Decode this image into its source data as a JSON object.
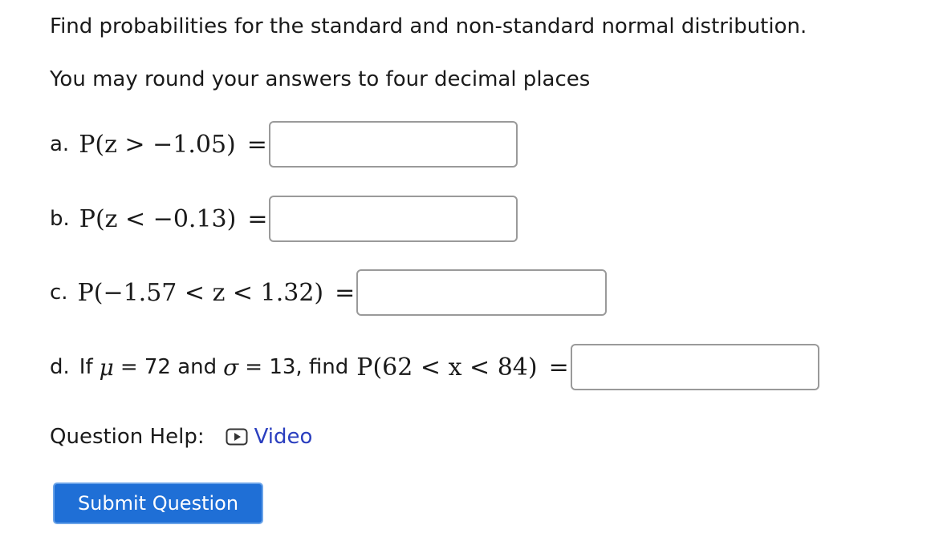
{
  "instructions": {
    "intro": "Find probabilities for the standard and non-standard normal distribution.",
    "note": "You may round your answers to four decimal places"
  },
  "questions": [
    {
      "letter": "a.",
      "expression": "P(z > −1.05)",
      "answer_value": ""
    },
    {
      "letter": "b.",
      "expression": "P(z < −0.13)",
      "answer_value": ""
    },
    {
      "letter": "c.",
      "expression": "P(−1.57 < z < 1.32)",
      "answer_value": ""
    },
    {
      "letter": "d.",
      "prefix": "If",
      "mu_symbol": "μ",
      "mu_value": "= 72 and",
      "sigma_symbol": "σ",
      "sigma_value": "= 13, find",
      "expression": "P(62 < x < 84)",
      "answer_value": ""
    }
  ],
  "equals": "=",
  "help": {
    "label": "Question Help:",
    "video_label": "Video",
    "video_icon": "play-icon",
    "link_color": "#2b3fbf"
  },
  "submit": {
    "label": "Submit Question",
    "color": "#1f6fd6"
  }
}
